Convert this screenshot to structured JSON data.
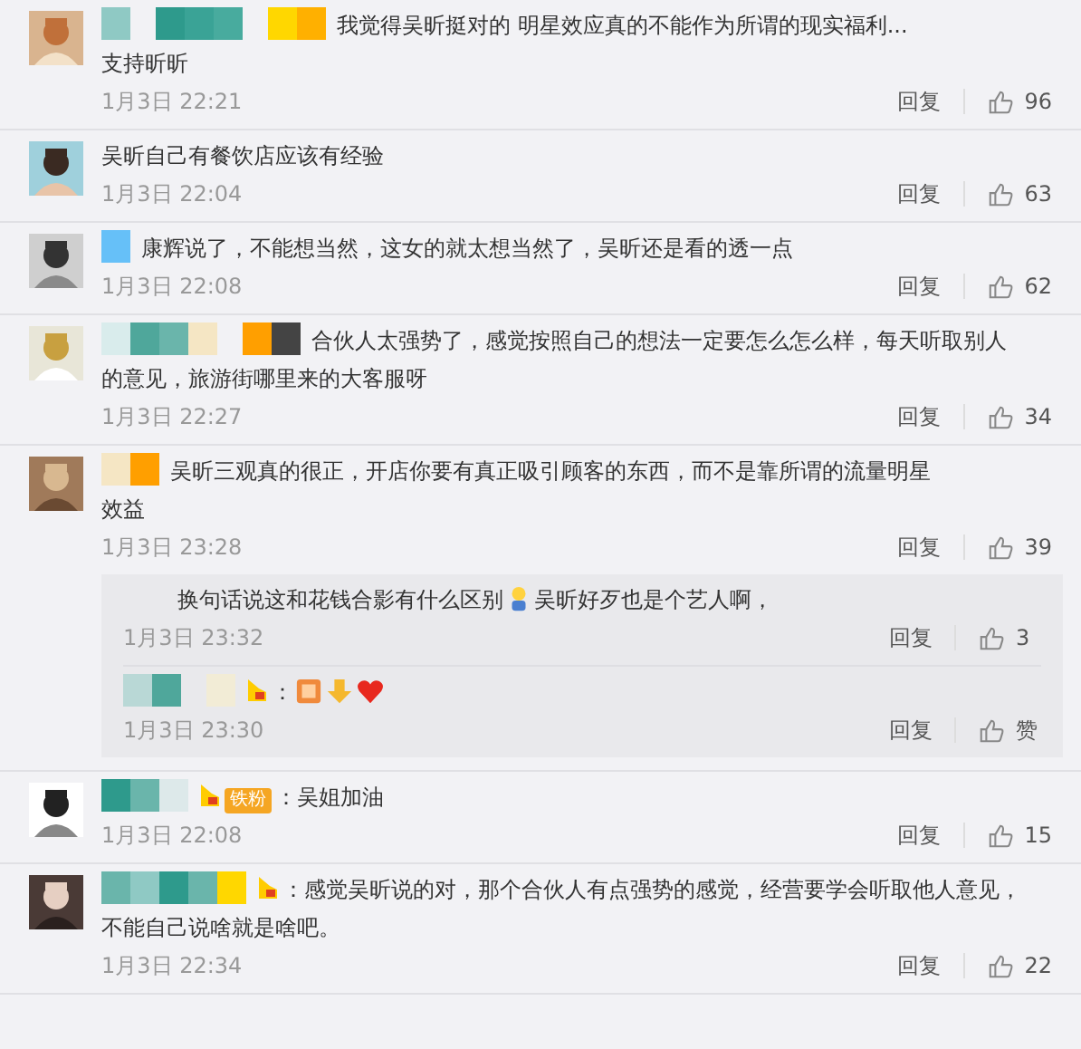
{
  "comments": [
    {
      "redacted": true,
      "vip": false,
      "lines": [
        "我觉得吴昕挺对的 明星效应真的不能作为所谓的现实福利...",
        "支持昕昕"
      ],
      "time": "1月3日 22:21",
      "reply": "回复",
      "likes": "96"
    },
    {
      "redacted": false,
      "vip": false,
      "lines": [
        "吴昕自己有餐饮店应该有经验"
      ],
      "time": "1月3日 22:04",
      "reply": "回复",
      "likes": "63"
    },
    {
      "redacted": true,
      "vip": false,
      "lines": [
        "康辉说了，不能想当然，这女的就太想当然了，吴昕还是看的透一点"
      ],
      "time": "1月3日 22:08",
      "reply": "回复",
      "likes": "62"
    },
    {
      "redacted": true,
      "vip": false,
      "lines": [
        "合伙人太强势了，感觉按照自己的想法一定要怎么怎么样，每天听取别人",
        "的意见，旅游街哪里来的大客服呀"
      ],
      "time": "1月3日 22:27",
      "reply": "回复",
      "likes": "34"
    },
    {
      "redacted": true,
      "vip": false,
      "lines": [
        "吴昕三观真的很正，开店你要有真正吸引顾客的东西，而不是靠所谓的流量明星",
        "效益"
      ],
      "time": "1月3日 23:28",
      "reply": "回复",
      "likes": "39",
      "replies": [
        {
          "redacted": false,
          "vip": false,
          "segments": [
            {
              "kind": "text",
              "text": "换句话说这和花钱合影有什么区别"
            },
            {
              "kind": "figure"
            },
            {
              "kind": "text",
              "text": "吴昕好歹也是个艺人啊，"
            }
          ],
          "time": "1月3日 23:32",
          "reply": "回复",
          "likes": "3"
        },
        {
          "redacted": true,
          "vip": true,
          "segments": [
            {
              "kind": "text",
              "text": "："
            },
            {
              "kind": "sticker"
            },
            {
              "kind": "arrow"
            },
            {
              "kind": "heart"
            }
          ],
          "time": "1月3日 23:30",
          "reply": "回复",
          "likes": "赞"
        }
      ]
    },
    {
      "redacted": true,
      "vip": true,
      "badge": "铁粉",
      "lines": [
        "：吴姐加油"
      ],
      "time": "1月3日 22:08",
      "reply": "回复",
      "likes": "15"
    },
    {
      "redacted": true,
      "vip": true,
      "lines": [
        "：感觉吴昕说的对，那个合伙人有点强势的感觉，经营要学会听取他人意见，",
        "不能自己说啥就是啥吧。"
      ],
      "time": "1月3日 22:34",
      "reply": "回复",
      "likes": "22"
    }
  ]
}
